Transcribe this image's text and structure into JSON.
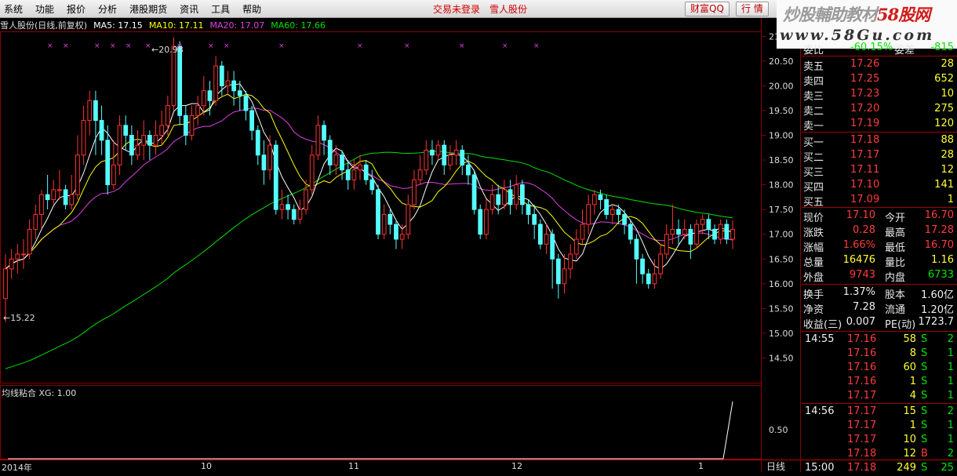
{
  "menu": {
    "items": [
      "系统",
      "功能",
      "报价",
      "分析",
      "港股期货",
      "资讯",
      "工具",
      "帮助"
    ],
    "status": "交易未登录",
    "stock_name": "雪人股份"
  },
  "buttons": {
    "caifu": "财富QQ",
    "hangqing": "行 情"
  },
  "watermark": {
    "line1a": "炒股輔助教材",
    "line1b": "58股网",
    "line2": "www.58Gu.com"
  },
  "header": {
    "title": "雪人股份(日线,前复权)",
    "ma5": "MA5: 17.15",
    "ma10": "MA10: 17.11",
    "ma20": "MA20: 17.07",
    "ma60": "MA60: 17.66"
  },
  "indicator": {
    "label": "均线粘合 XG: 1.00",
    "tick": "0.50"
  },
  "annotations": {
    "high": "20.98",
    "low": "15.22"
  },
  "colors": {
    "ma5": "#ffffff",
    "ma10": "#ffff00",
    "ma20": "#e040e0",
    "ma60": "#00e000",
    "up": "#ff3232",
    "down": "#54ffff",
    "grid": "#8b0000"
  },
  "price_axis": [
    "21.00",
    "20.50",
    "20.00",
    "19.50",
    "19.00",
    "18.50",
    "18.00",
    "17.50",
    "17.00",
    "16.50",
    "16.00",
    "15.50",
    "15.00",
    "14.50"
  ],
  "date_axis": [
    "2014年",
    "10",
    "11",
    "12",
    "1"
  ],
  "period_label": "日线",
  "quote_partial": {
    "label1": "委比",
    "value1": "-60.15%",
    "label2": "委差",
    "value2": "-815"
  },
  "order_book": [
    {
      "label": "卖五",
      "price": "17.26",
      "vol": "28"
    },
    {
      "label": "卖四",
      "price": "17.25",
      "vol": "652"
    },
    {
      "label": "卖三",
      "price": "17.23",
      "vol": "10"
    },
    {
      "label": "卖二",
      "price": "17.20",
      "vol": "275"
    },
    {
      "label": "卖一",
      "price": "17.19",
      "vol": "120"
    },
    {
      "label": "买一",
      "price": "17.18",
      "vol": "88"
    },
    {
      "label": "买二",
      "price": "17.17",
      "vol": "28"
    },
    {
      "label": "买三",
      "price": "17.11",
      "vol": "12"
    },
    {
      "label": "买四",
      "price": "17.10",
      "vol": "141"
    },
    {
      "label": "买五",
      "price": "17.09",
      "vol": "1"
    }
  ],
  "stats": [
    {
      "l1": "现价",
      "v1": "17.10",
      "l2": "今开",
      "v2": "16.70"
    },
    {
      "l1": "涨跌",
      "v1": "0.28",
      "l2": "最高",
      "v2": "17.28"
    },
    {
      "l1": "涨幅",
      "v1": "1.66%",
      "l2": "最低",
      "v2": "16.70"
    },
    {
      "l1": "总量",
      "v1": "16476",
      "l2": "量比",
      "v2": "1.16"
    },
    {
      "l1": "外盘",
      "v1": "9743",
      "l2": "内盘",
      "v2": "6733"
    }
  ],
  "fundamentals": [
    {
      "l1": "换手",
      "v1": "1.37%",
      "l2": "股本",
      "v2": "1.60亿"
    },
    {
      "l1": "净资",
      "v1": "7.28",
      "l2": "流通",
      "v2": "1.20亿"
    },
    {
      "l1": "收益(三)",
      "v1": "0.007",
      "l2": "PE(动)",
      "v2": "1723.7"
    }
  ],
  "ticks": [
    {
      "time": "14:55",
      "price": "17.16",
      "vol": "58",
      "side": "S",
      "n": "2"
    },
    {
      "time": "",
      "price": "17.16",
      "vol": "8",
      "side": "S",
      "n": "1"
    },
    {
      "time": "",
      "price": "17.16",
      "vol": "60",
      "side": "S",
      "n": "1"
    },
    {
      "time": "",
      "price": "17.16",
      "vol": "1",
      "side": "S",
      "n": "1"
    },
    {
      "time": "",
      "price": "17.17",
      "vol": "4",
      "side": "S",
      "n": "1"
    },
    {
      "time": "14:56",
      "price": "17.17",
      "vol": "15",
      "side": "S",
      "n": "2"
    },
    {
      "time": "",
      "price": "17.17",
      "vol": "1",
      "side": "S",
      "n": "1"
    },
    {
      "time": "",
      "price": "17.17",
      "vol": "10",
      "side": "S",
      "n": "1"
    },
    {
      "time": "",
      "price": "17.18",
      "vol": "12",
      "side": "B",
      "n": "2"
    },
    {
      "time": "15:00",
      "price": "17.18",
      "vol": "249",
      "side": "S",
      "n": "25"
    }
  ],
  "chart_data": {
    "type": "candlestick",
    "price_range": [
      14.0,
      21.1
    ],
    "candles": [
      {
        "o": 15.7,
        "c": 16.3,
        "h": 16.6,
        "l": 15.22
      },
      {
        "o": 16.3,
        "c": 16.5,
        "h": 16.7,
        "l": 16.1
      },
      {
        "o": 16.5,
        "c": 16.6,
        "h": 16.8,
        "l": 16.2
      },
      {
        "o": 16.6,
        "c": 16.6,
        "h": 16.9,
        "l": 16.3
      },
      {
        "o": 16.6,
        "c": 17.1,
        "h": 17.3,
        "l": 16.5
      },
      {
        "o": 17.1,
        "c": 17.4,
        "h": 17.6,
        "l": 16.9
      },
      {
        "o": 17.4,
        "c": 17.8,
        "h": 17.9,
        "l": 17.1
      },
      {
        "o": 17.8,
        "c": 17.7,
        "h": 18.2,
        "l": 17.5
      },
      {
        "o": 17.7,
        "c": 17.9,
        "h": 18.1,
        "l": 17.6
      },
      {
        "o": 17.9,
        "c": 17.9,
        "h": 18.3,
        "l": 17.7
      },
      {
        "o": 17.9,
        "c": 17.6,
        "h": 18.0,
        "l": 17.5
      },
      {
        "o": 17.6,
        "c": 17.8,
        "h": 18.2,
        "l": 17.5
      },
      {
        "o": 17.8,
        "c": 18.6,
        "h": 19.0,
        "l": 17.7
      },
      {
        "o": 18.6,
        "c": 19.3,
        "h": 19.6,
        "l": 18.4
      },
      {
        "o": 19.3,
        "c": 19.7,
        "h": 19.9,
        "l": 19.0
      },
      {
        "o": 19.7,
        "c": 19.3,
        "h": 19.9,
        "l": 18.6
      },
      {
        "o": 19.3,
        "c": 18.9,
        "h": 19.6,
        "l": 18.6
      },
      {
        "o": 18.9,
        "c": 18.0,
        "h": 19.2,
        "l": 17.8
      },
      {
        "o": 18.0,
        "c": 18.4,
        "h": 18.9,
        "l": 17.9
      },
      {
        "o": 18.4,
        "c": 19.2,
        "h": 19.4,
        "l": 18.2
      },
      {
        "o": 19.2,
        "c": 19.0,
        "h": 19.4,
        "l": 18.7
      },
      {
        "o": 19.0,
        "c": 18.6,
        "h": 19.2,
        "l": 18.4
      },
      {
        "o": 18.6,
        "c": 18.8,
        "h": 19.1,
        "l": 18.5
      },
      {
        "o": 18.8,
        "c": 19.0,
        "h": 19.3,
        "l": 18.5
      },
      {
        "o": 19.0,
        "c": 18.8,
        "h": 19.1,
        "l": 18.5
      },
      {
        "o": 18.8,
        "c": 19.0,
        "h": 19.3,
        "l": 18.6
      },
      {
        "o": 19.0,
        "c": 19.2,
        "h": 19.5,
        "l": 18.8
      },
      {
        "o": 19.2,
        "c": 19.6,
        "h": 19.8,
        "l": 19.0
      },
      {
        "o": 19.6,
        "c": 20.8,
        "h": 20.98,
        "l": 19.5
      },
      {
        "o": 20.8,
        "c": 19.4,
        "h": 20.9,
        "l": 19.2
      },
      {
        "o": 19.4,
        "c": 19.0,
        "h": 19.6,
        "l": 18.8
      },
      {
        "o": 19.0,
        "c": 19.4,
        "h": 19.6,
        "l": 18.9
      },
      {
        "o": 19.4,
        "c": 19.6,
        "h": 19.8,
        "l": 19.2
      },
      {
        "o": 19.6,
        "c": 19.9,
        "h": 20.2,
        "l": 19.4
      },
      {
        "o": 19.9,
        "c": 19.7,
        "h": 20.1,
        "l": 19.4
      },
      {
        "o": 19.7,
        "c": 20.4,
        "h": 20.6,
        "l": 19.6
      },
      {
        "o": 20.4,
        "c": 20.0,
        "h": 20.5,
        "l": 19.8
      },
      {
        "o": 20.0,
        "c": 20.1,
        "h": 20.3,
        "l": 19.8
      },
      {
        "o": 20.1,
        "c": 19.9,
        "h": 20.3,
        "l": 19.6
      },
      {
        "o": 19.9,
        "c": 19.8,
        "h": 20.1,
        "l": 19.5
      },
      {
        "o": 19.8,
        "c": 19.5,
        "h": 19.9,
        "l": 19.3
      },
      {
        "o": 19.5,
        "c": 19.1,
        "h": 19.6,
        "l": 18.9
      },
      {
        "o": 19.1,
        "c": 18.6,
        "h": 19.2,
        "l": 18.4
      },
      {
        "o": 18.6,
        "c": 18.3,
        "h": 18.9,
        "l": 18.0
      },
      {
        "o": 18.3,
        "c": 18.8,
        "h": 19.0,
        "l": 18.1
      },
      {
        "o": 18.8,
        "c": 17.5,
        "h": 18.9,
        "l": 17.4
      },
      {
        "o": 17.5,
        "c": 17.6,
        "h": 17.9,
        "l": 17.3
      },
      {
        "o": 17.6,
        "c": 17.5,
        "h": 17.8,
        "l": 17.3
      },
      {
        "o": 17.5,
        "c": 17.3,
        "h": 17.6,
        "l": 17.2
      },
      {
        "o": 17.3,
        "c": 17.5,
        "h": 17.7,
        "l": 17.2
      },
      {
        "o": 17.5,
        "c": 17.9,
        "h": 18.1,
        "l": 17.4
      },
      {
        "o": 17.9,
        "c": 18.6,
        "h": 18.8,
        "l": 17.8
      },
      {
        "o": 18.6,
        "c": 19.2,
        "h": 19.4,
        "l": 18.5
      },
      {
        "o": 19.2,
        "c": 18.9,
        "h": 19.3,
        "l": 18.6
      },
      {
        "o": 18.9,
        "c": 18.4,
        "h": 19.0,
        "l": 18.2
      },
      {
        "o": 18.4,
        "c": 18.6,
        "h": 18.8,
        "l": 18.2
      },
      {
        "o": 18.6,
        "c": 18.3,
        "h": 18.7,
        "l": 18.1
      },
      {
        "o": 18.3,
        "c": 18.1,
        "h": 18.5,
        "l": 17.9
      },
      {
        "o": 18.1,
        "c": 18.3,
        "h": 18.5,
        "l": 17.9
      },
      {
        "o": 18.3,
        "c": 18.4,
        "h": 18.6,
        "l": 18.1
      },
      {
        "o": 18.4,
        "c": 18.1,
        "h": 18.5,
        "l": 18.0
      },
      {
        "o": 18.1,
        "c": 17.9,
        "h": 18.3,
        "l": 17.8
      },
      {
        "o": 17.9,
        "c": 17.0,
        "h": 18.0,
        "l": 16.9
      },
      {
        "o": 17.0,
        "c": 17.4,
        "h": 17.6,
        "l": 16.9
      },
      {
        "o": 17.4,
        "c": 17.2,
        "h": 17.5,
        "l": 17.0
      },
      {
        "o": 17.2,
        "c": 16.9,
        "h": 17.3,
        "l": 16.7
      },
      {
        "o": 16.9,
        "c": 17.0,
        "h": 17.2,
        "l": 16.7
      },
      {
        "o": 17.0,
        "c": 17.6,
        "h": 17.8,
        "l": 16.9
      },
      {
        "o": 17.6,
        "c": 18.1,
        "h": 18.3,
        "l": 17.5
      },
      {
        "o": 18.1,
        "c": 18.3,
        "h": 18.6,
        "l": 18.0
      },
      {
        "o": 18.3,
        "c": 18.7,
        "h": 18.9,
        "l": 18.2
      },
      {
        "o": 18.7,
        "c": 18.6,
        "h": 18.9,
        "l": 18.4
      },
      {
        "o": 18.6,
        "c": 18.8,
        "h": 18.9,
        "l": 18.5
      },
      {
        "o": 18.8,
        "c": 18.4,
        "h": 18.9,
        "l": 18.2
      },
      {
        "o": 18.4,
        "c": 18.6,
        "h": 18.8,
        "l": 18.3
      },
      {
        "o": 18.6,
        "c": 18.7,
        "h": 18.9,
        "l": 18.4
      },
      {
        "o": 18.7,
        "c": 18.4,
        "h": 18.8,
        "l": 18.2
      },
      {
        "o": 18.4,
        "c": 18.2,
        "h": 18.6,
        "l": 18.0
      },
      {
        "o": 18.2,
        "c": 17.5,
        "h": 18.3,
        "l": 17.4
      },
      {
        "o": 17.5,
        "c": 17.0,
        "h": 17.6,
        "l": 16.9
      },
      {
        "o": 17.0,
        "c": 17.5,
        "h": 17.7,
        "l": 16.9
      },
      {
        "o": 17.5,
        "c": 17.8,
        "h": 18.0,
        "l": 17.4
      },
      {
        "o": 17.8,
        "c": 17.6,
        "h": 18.0,
        "l": 17.4
      },
      {
        "o": 17.6,
        "c": 17.9,
        "h": 18.1,
        "l": 17.5
      },
      {
        "o": 17.9,
        "c": 17.6,
        "h": 18.1,
        "l": 17.4
      },
      {
        "o": 17.6,
        "c": 18.0,
        "h": 18.2,
        "l": 17.5
      },
      {
        "o": 18.0,
        "c": 17.6,
        "h": 18.1,
        "l": 17.4
      },
      {
        "o": 17.6,
        "c": 17.4,
        "h": 17.7,
        "l": 17.2
      },
      {
        "o": 17.4,
        "c": 17.2,
        "h": 17.6,
        "l": 16.9
      },
      {
        "o": 17.2,
        "c": 16.8,
        "h": 17.3,
        "l": 16.7
      },
      {
        "o": 16.8,
        "c": 17.0,
        "h": 17.2,
        "l": 16.6
      },
      {
        "o": 17.0,
        "c": 16.5,
        "h": 17.1,
        "l": 15.9
      },
      {
        "o": 16.5,
        "c": 16.0,
        "h": 16.6,
        "l": 15.7
      },
      {
        "o": 16.0,
        "c": 16.3,
        "h": 16.6,
        "l": 15.8
      },
      {
        "o": 16.3,
        "c": 16.6,
        "h": 16.8,
        "l": 16.1
      },
      {
        "o": 16.6,
        "c": 16.9,
        "h": 17.1,
        "l": 16.5
      },
      {
        "o": 16.9,
        "c": 17.2,
        "h": 17.5,
        "l": 16.8
      },
      {
        "o": 17.2,
        "c": 17.6,
        "h": 17.8,
        "l": 17.0
      },
      {
        "o": 17.6,
        "c": 17.8,
        "h": 17.9,
        "l": 17.4
      },
      {
        "o": 17.8,
        "c": 17.7,
        "h": 17.9,
        "l": 17.5
      },
      {
        "o": 17.7,
        "c": 17.4,
        "h": 17.8,
        "l": 17.3
      },
      {
        "o": 17.4,
        "c": 17.5,
        "h": 17.6,
        "l": 17.2
      },
      {
        "o": 17.5,
        "c": 17.4,
        "h": 17.6,
        "l": 17.2
      },
      {
        "o": 17.4,
        "c": 17.2,
        "h": 17.5,
        "l": 17.0
      },
      {
        "o": 17.2,
        "c": 16.9,
        "h": 17.3,
        "l": 16.8
      },
      {
        "o": 16.9,
        "c": 16.5,
        "h": 17.0,
        "l": 16.0
      },
      {
        "o": 16.5,
        "c": 16.2,
        "h": 16.6,
        "l": 16.0
      },
      {
        "o": 16.2,
        "c": 16.0,
        "h": 16.3,
        "l": 15.9
      },
      {
        "o": 16.0,
        "c": 16.2,
        "h": 16.5,
        "l": 15.9
      },
      {
        "o": 16.2,
        "c": 16.6,
        "h": 16.8,
        "l": 16.1
      },
      {
        "o": 16.6,
        "c": 17.0,
        "h": 17.2,
        "l": 16.5
      },
      {
        "o": 17.0,
        "c": 17.1,
        "h": 17.6,
        "l": 16.8
      },
      {
        "o": 17.1,
        "c": 17.0,
        "h": 17.3,
        "l": 16.8
      },
      {
        "o": 17.0,
        "c": 17.1,
        "h": 17.3,
        "l": 16.9
      },
      {
        "o": 17.1,
        "c": 16.8,
        "h": 17.2,
        "l": 16.5
      },
      {
        "o": 16.8,
        "c": 17.2,
        "h": 17.3,
        "l": 16.7
      },
      {
        "o": 17.2,
        "c": 17.3,
        "h": 17.4,
        "l": 17.0
      },
      {
        "o": 17.3,
        "c": 17.1,
        "h": 17.4,
        "l": 16.9
      },
      {
        "o": 17.1,
        "c": 16.9,
        "h": 17.2,
        "l": 16.8
      },
      {
        "o": 16.9,
        "c": 17.2,
        "h": 17.3,
        "l": 16.8
      },
      {
        "o": 17.2,
        "c": 16.9,
        "h": 17.3,
        "l": 16.8
      },
      {
        "o": 16.9,
        "c": 17.1,
        "h": 17.28,
        "l": 16.7
      }
    ]
  }
}
